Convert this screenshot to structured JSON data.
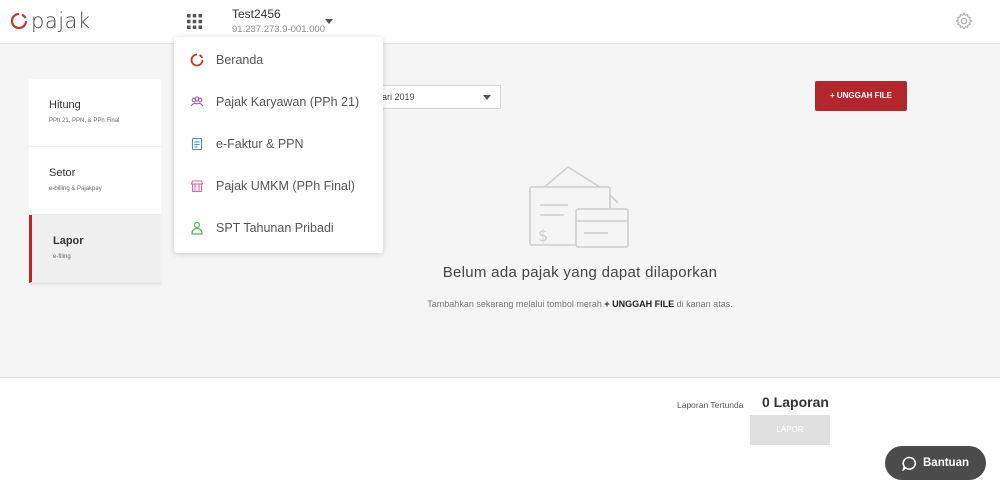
{
  "header": {
    "logo_text": "pajak",
    "company_name": "Test2456",
    "company_npwp": "91.237.273.9-001.000"
  },
  "sidebar": {
    "items": [
      {
        "label": "Hitung",
        "sub": "PPh 21, PPN, & PPh Final"
      },
      {
        "label": "Setor",
        "sub": "e-billing & Pajakpay"
      },
      {
        "label": "Lapor",
        "sub": "e-filing"
      }
    ]
  },
  "main": {
    "period_value": "ari 2019",
    "upload_label": "+ UNGGAH FILE",
    "empty_title": "Belum ada pajak yang dapat dilaporkan",
    "empty_hint_prefix": "Tambahkan sekarang melalui tombol merah ",
    "empty_hint_bold": "+ UNGGAH FILE",
    "empty_hint_suffix": " di kanan atas."
  },
  "footer": {
    "pending_label": "Laporan Tertunda",
    "pending_count": "0 Laporan",
    "lapor_label": "LAPOR"
  },
  "help": {
    "label": "Bantuan"
  },
  "menu": {
    "items": [
      {
        "label": "Beranda",
        "icon": "home-logo-icon"
      },
      {
        "label": "Pajak Karyawan (PPh 21)",
        "icon": "employees-icon"
      },
      {
        "label": "e-Faktur & PPN",
        "icon": "invoice-icon"
      },
      {
        "label": "Pajak UMKM (PPh Final)",
        "icon": "store-icon"
      },
      {
        "label": "SPT Tahunan Pribadi",
        "icon": "person-icon"
      }
    ]
  },
  "colors": {
    "accent": "#b3262c",
    "menu_employees": "#9b59b6",
    "menu_invoice": "#4a90d9",
    "menu_store": "#e06aa8",
    "menu_person": "#5cb85c"
  }
}
